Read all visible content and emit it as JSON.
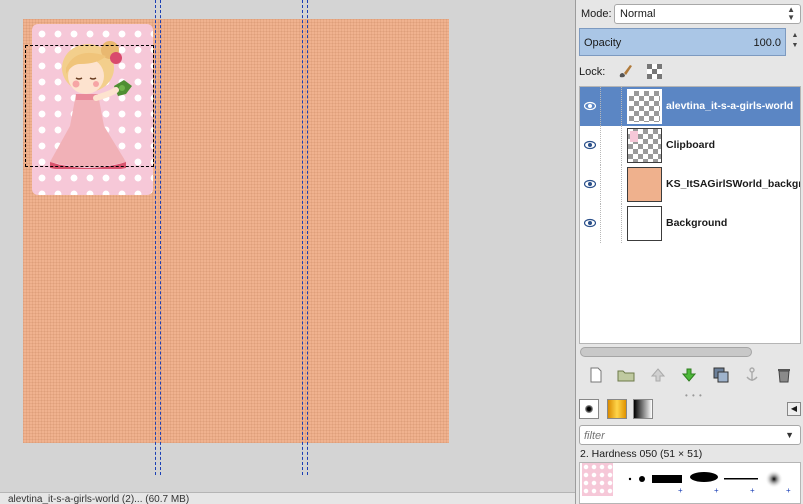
{
  "canvas": {
    "status_text": "alevtina_it-s-a-girls-world (2)... (60.7 MB)"
  },
  "dock": {
    "mode": {
      "label": "Mode:",
      "value": "Normal"
    },
    "opacity": {
      "label": "Opacity",
      "value": "100.0",
      "fraction": 1.0
    },
    "lock": {
      "label": "Lock:"
    },
    "layers": [
      {
        "name": "alevtina_it-s-a-girls-world",
        "visible": true,
        "selected": true,
        "thumb": "checker"
      },
      {
        "name": "Clipboard",
        "visible": true,
        "selected": false,
        "thumb": "checker"
      },
      {
        "name": "KS_ItSAGirlSWorld_background",
        "visible": true,
        "selected": false,
        "thumb": "peach"
      },
      {
        "name": "Background",
        "visible": true,
        "selected": false,
        "thumb": "white"
      }
    ],
    "layer_buttons": [
      "new-layer-icon",
      "new-layer-group-icon",
      "raise-layer-icon",
      "lower-layer-icon",
      "duplicate-layer-icon",
      "anchor-layer-icon",
      "delete-layer-icon"
    ],
    "brushes": {
      "tabs": [
        "brushes-tab-icon",
        "patterns-tab-icon",
        "gradients-tab-icon"
      ],
      "filter_placeholder": "filter",
      "selected_brush": "2. Hardness 050 (51 × 51)"
    }
  },
  "colors": {
    "selected_row": "#5b86c4",
    "opacity_bar": "#aac6e6",
    "canvas_fill": "#f0b28f",
    "guide": "#1a3fb5"
  }
}
